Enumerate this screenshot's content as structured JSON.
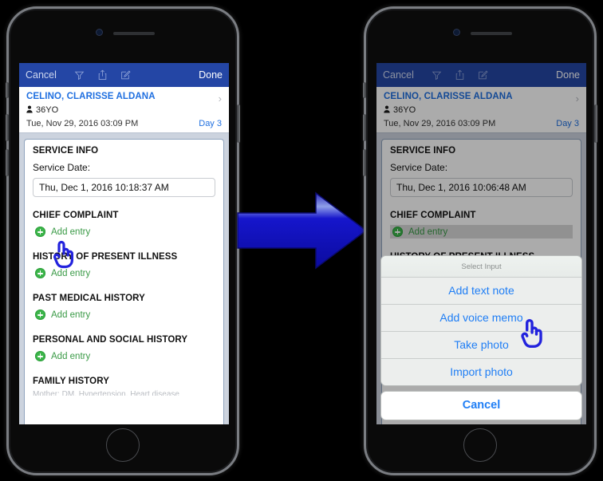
{
  "navbar": {
    "cancel_label": "Cancel",
    "done_label": "Done",
    "icons": [
      "filter-icon",
      "share-icon",
      "compose-icon"
    ]
  },
  "patient": {
    "name": "CELINO, CLARISSE ALDANA",
    "age": "36YO",
    "datetime": "Tue, Nov 29, 2016 03:09 PM",
    "day_badge": "Day 3",
    "person_icon": "person-icon",
    "disclosure_icon": "chevron-right-icon"
  },
  "form": {
    "service_info_title": "SERVICE INFO",
    "service_date_label": "Service Date:",
    "service_date_left": "Thu, Dec 1, 2016 10:18:37 AM",
    "service_date_right": "Thu, Dec 1, 2016 10:06:48 AM",
    "add_entry_label": "Add entry",
    "sections": [
      {
        "title": "CHIEF COMPLAINT"
      },
      {
        "title": "HISTORY OF PRESENT ILLNESS"
      },
      {
        "title": "PAST MEDICAL HISTORY"
      },
      {
        "title": "PERSONAL AND SOCIAL HISTORY"
      },
      {
        "title": "FAMILY HISTORY"
      }
    ],
    "family_history_cut_text": "Mother: DM, Hypertension, Heart disease"
  },
  "action_sheet": {
    "title": "Select Input",
    "options": [
      "Add text note",
      "Add voice memo",
      "Take photo",
      "Import photo"
    ],
    "cancel_label": "Cancel"
  },
  "colors": {
    "navbar_blue": "#2446a5",
    "link_blue": "#1f6fe0",
    "sheet_blue": "#1f7ef5",
    "add_green": "#3a9a46",
    "plus_green": "#3cb54a",
    "form_backdrop": "#ccd3de",
    "arrow_blue": "#1414d2"
  },
  "annotations": {
    "left_cursor": "pointing-hand-cursor",
    "right_cursor": "pointing-hand-cursor",
    "transition_arrow": "right-arrow-icon"
  }
}
